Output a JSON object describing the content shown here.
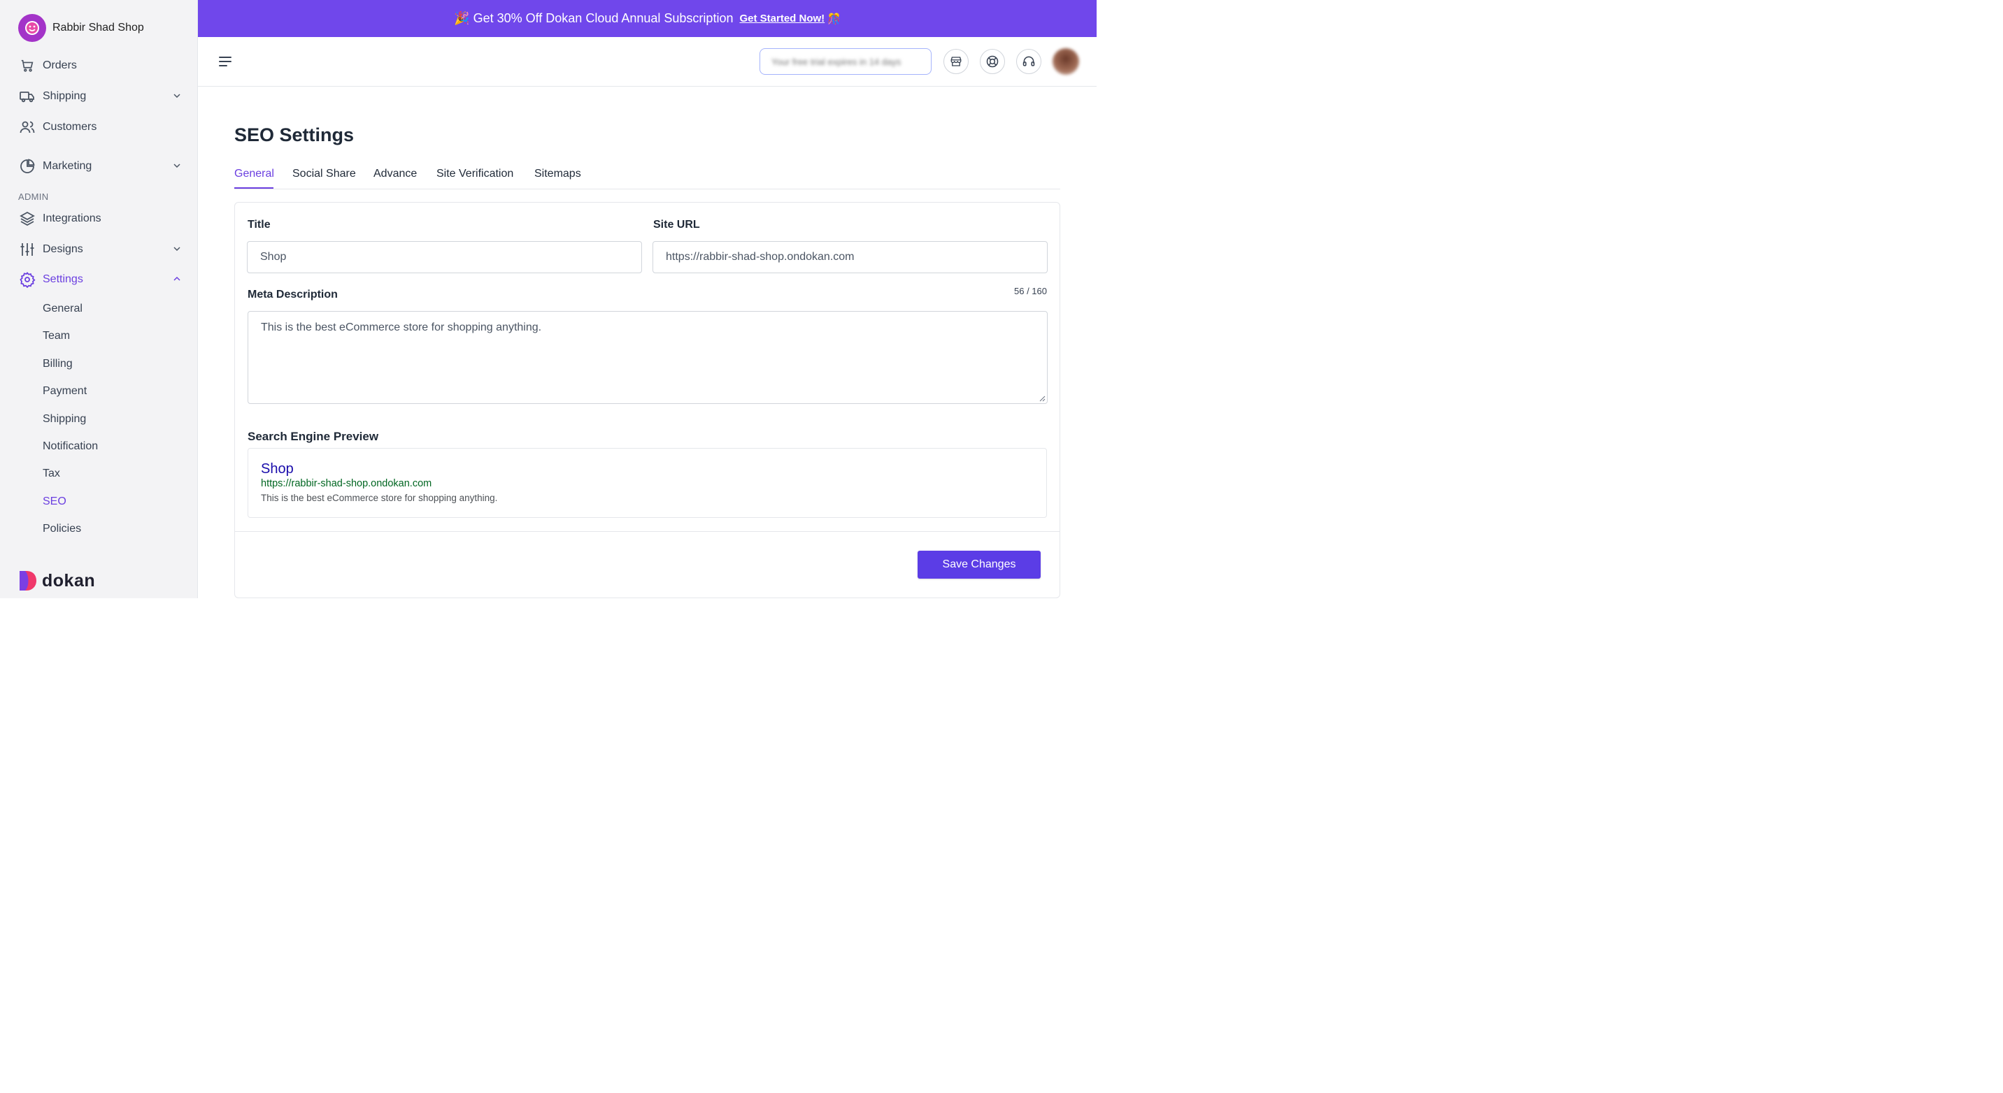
{
  "brand": {
    "name": "Rabbir Shad Shop",
    "footer_name": "dokan"
  },
  "banner": {
    "text": "🎉 Get 30% Off Dokan Cloud Annual Subscription",
    "cta": "Get Started Now!",
    "cta_emoji": "🎊"
  },
  "sidebar": {
    "items": [
      {
        "label": "Orders",
        "icon": "cart-icon"
      },
      {
        "label": "Shipping",
        "icon": "truck-icon",
        "expandable": true
      },
      {
        "label": "Customers",
        "icon": "users-icon"
      },
      {
        "label": "Marketing",
        "icon": "pie-chart-icon",
        "expandable": true
      }
    ],
    "section_label": "ADMIN",
    "admin_items": [
      {
        "label": "Integrations",
        "icon": "layers-icon"
      },
      {
        "label": "Designs",
        "icon": "sliders-icon",
        "expandable": true
      },
      {
        "label": "Settings",
        "icon": "gear-icon",
        "expanded": true,
        "active": true
      }
    ],
    "settings_sub": [
      {
        "label": "General"
      },
      {
        "label": "Team"
      },
      {
        "label": "Billing"
      },
      {
        "label": "Payment"
      },
      {
        "label": "Shipping"
      },
      {
        "label": "Notification"
      },
      {
        "label": "Tax"
      },
      {
        "label": "SEO",
        "active": true
      },
      {
        "label": "Policies"
      }
    ]
  },
  "topbar": {
    "search_placeholder": "Your free trial expires in 14 days",
    "icons": [
      "store-icon",
      "support-ring-icon",
      "headset-icon"
    ]
  },
  "page": {
    "title": "SEO Settings",
    "tabs": [
      {
        "label": "General",
        "active": true
      },
      {
        "label": "Social Share"
      },
      {
        "label": "Advance"
      },
      {
        "label": "Site Verification"
      },
      {
        "label": "Sitemaps"
      }
    ]
  },
  "form": {
    "title_label": "Title",
    "title_value": "Shop",
    "site_url_label": "Site URL",
    "site_url_value": "https://rabbir-shad-shop.ondokan.com",
    "meta_label": "Meta Description",
    "meta_counter": "56 / 160",
    "meta_value": "This is the best eCommerce store for shopping anything.",
    "preview_label": "Search Engine Preview",
    "preview": {
      "title": "Shop",
      "url": "https://rabbir-shad-shop.ondokan.com",
      "description": "This is the best eCommerce store for shopping anything."
    },
    "save_label": "Save Changes"
  },
  "colors": {
    "accent": "#6b3fe0",
    "banner": "#7047eb",
    "button": "#5b3de6",
    "preview_title": "#1a0dab",
    "preview_url": "#006621"
  }
}
